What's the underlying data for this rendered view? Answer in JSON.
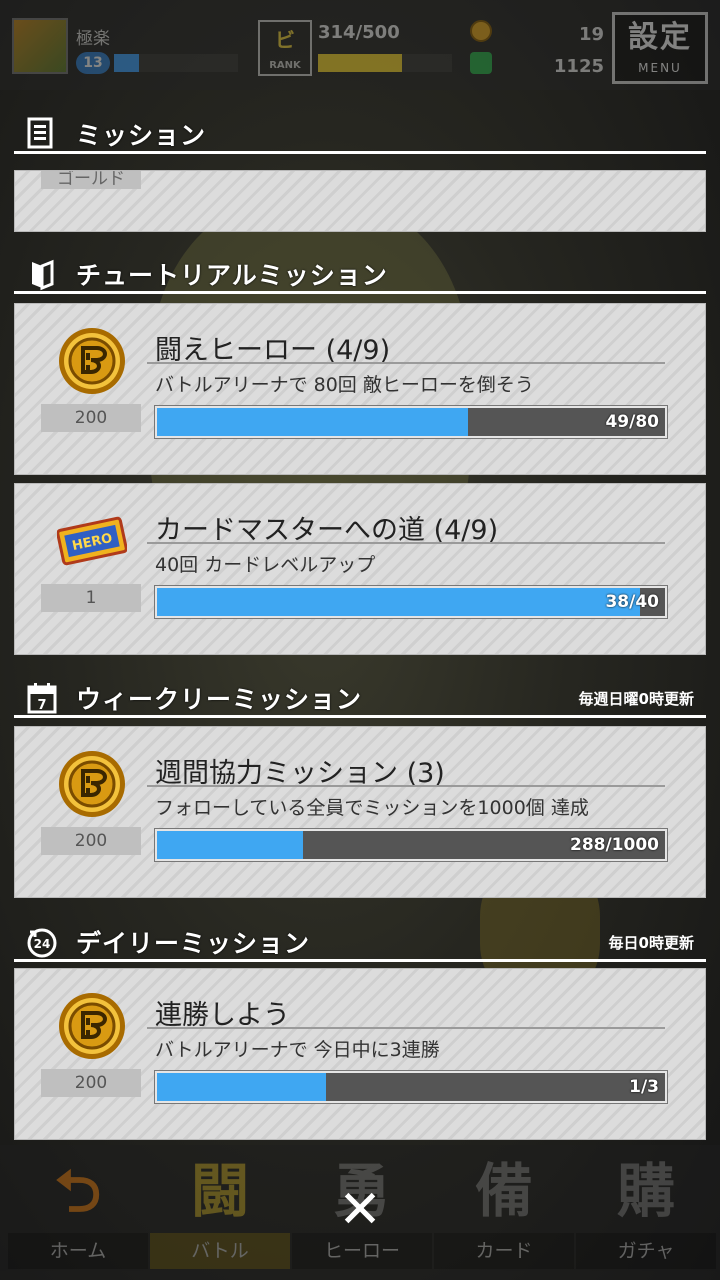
{
  "header": {
    "player_name": "極楽",
    "level": "13",
    "exp_fraction": 0.2,
    "rank_label": "RANK",
    "stamina_text": "314/500",
    "stamina_fraction": 0.63,
    "coins": "19",
    "gems": "1125",
    "settings_label": "設定",
    "settings_sub": "MENU"
  },
  "panel": {
    "title": "ミッション",
    "partial_card_label": "ゴールド",
    "sections": [
      {
        "title": "チュートリアルミッション",
        "note": "",
        "cards": [
          {
            "title": "闘えヒーロー (4/9)",
            "desc": "バトルアリーナで 80回 敵ヒーローを倒そう",
            "reward_count": "200",
            "progress_label": "49/80",
            "progress": 0.6125,
            "reward_icon": "gold-coin-icon"
          },
          {
            "title": "カードマスターへの道 (4/9)",
            "desc": "40回 カードレベルアップ",
            "reward_count": "1",
            "progress_label": "38/40",
            "progress": 0.95,
            "reward_icon": "hero-ticket-icon"
          }
        ]
      },
      {
        "title": "ウィークリーミッション",
        "note": "毎週日曜0時更新",
        "cards": [
          {
            "title": "週間協力ミッション (3)",
            "desc": "フォローしている全員でミッションを1000個 達成",
            "reward_count": "200",
            "progress_label": "288/1000",
            "progress": 0.288,
            "reward_icon": "gold-coin-icon"
          }
        ]
      },
      {
        "title": "デイリーミッション",
        "note": "毎日0時更新",
        "cards": [
          {
            "title": "連勝しよう",
            "desc": "バトルアリーナで 今日中に3連勝",
            "reward_count": "200",
            "progress_label": "1/3",
            "progress": 0.333,
            "reward_icon": "gold-coin-icon"
          }
        ]
      }
    ]
  },
  "nav": {
    "tabs": [
      {
        "label": "ホーム",
        "glyph": "⮌"
      },
      {
        "label": "バトル",
        "glyph": "闘"
      },
      {
        "label": "ヒーロー",
        "glyph": "勇"
      },
      {
        "label": "カード",
        "glyph": "備"
      },
      {
        "label": "ガチャ",
        "glyph": "購"
      }
    ],
    "close_glyph": "✕"
  },
  "colors": {
    "progress_fill": "#3fa7f2",
    "accent_gold": "#e9a91c"
  }
}
